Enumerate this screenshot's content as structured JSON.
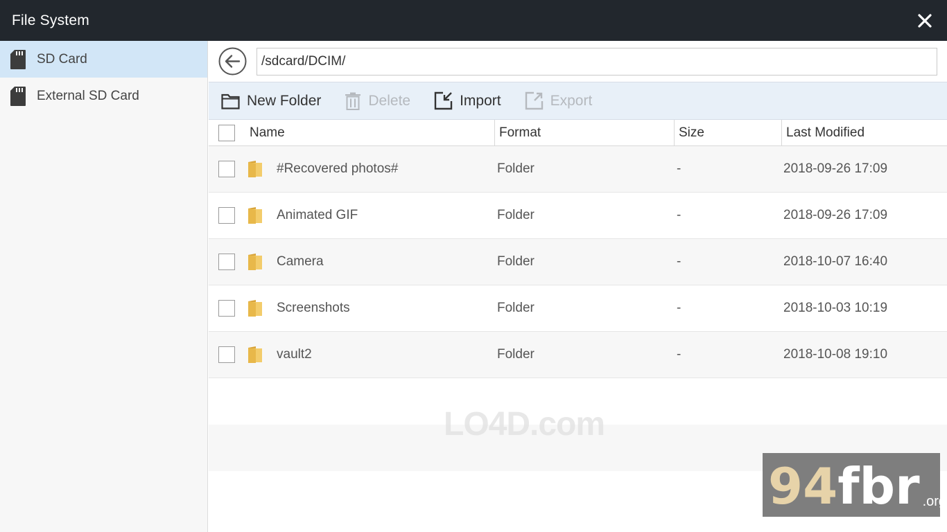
{
  "window": {
    "title": "File System",
    "close_glyph": "✕"
  },
  "sidebar": {
    "items": [
      {
        "label": "SD Card",
        "icon": "sd-card-icon",
        "active": true
      },
      {
        "label": "External SD Card",
        "icon": "sd-card-icon",
        "active": false
      }
    ]
  },
  "path": {
    "value": "/sdcard/DCIM/"
  },
  "toolbar": {
    "new_folder": "New Folder",
    "delete": "Delete",
    "import": "Import",
    "export": "Export"
  },
  "table": {
    "headers": {
      "name": "Name",
      "format": "Format",
      "size": "Size",
      "modified": "Last Modified"
    },
    "rows": [
      {
        "name": "#Recovered photos#",
        "format": "Folder",
        "size": "-",
        "modified": "2018-09-26 17:09"
      },
      {
        "name": "Animated GIF",
        "format": "Folder",
        "size": "-",
        "modified": "2018-09-26 17:09"
      },
      {
        "name": "Camera",
        "format": "Folder",
        "size": "-",
        "modified": "2018-10-07 16:40"
      },
      {
        "name": "Screenshots",
        "format": "Folder",
        "size": "-",
        "modified": "2018-10-03 10:19"
      },
      {
        "name": "vault2",
        "format": "Folder",
        "size": "-",
        "modified": "2018-10-08 19:10"
      }
    ]
  },
  "watermark": {
    "text": "LO4D.com"
  },
  "badge": {
    "number": "94",
    "text": "fbr",
    "tld": ".org"
  },
  "colors": {
    "titlebar": "#22272d",
    "sidebar_active": "#d2e6f7",
    "toolbar": "#e8f0f8",
    "folder": "#e8b84a"
  }
}
